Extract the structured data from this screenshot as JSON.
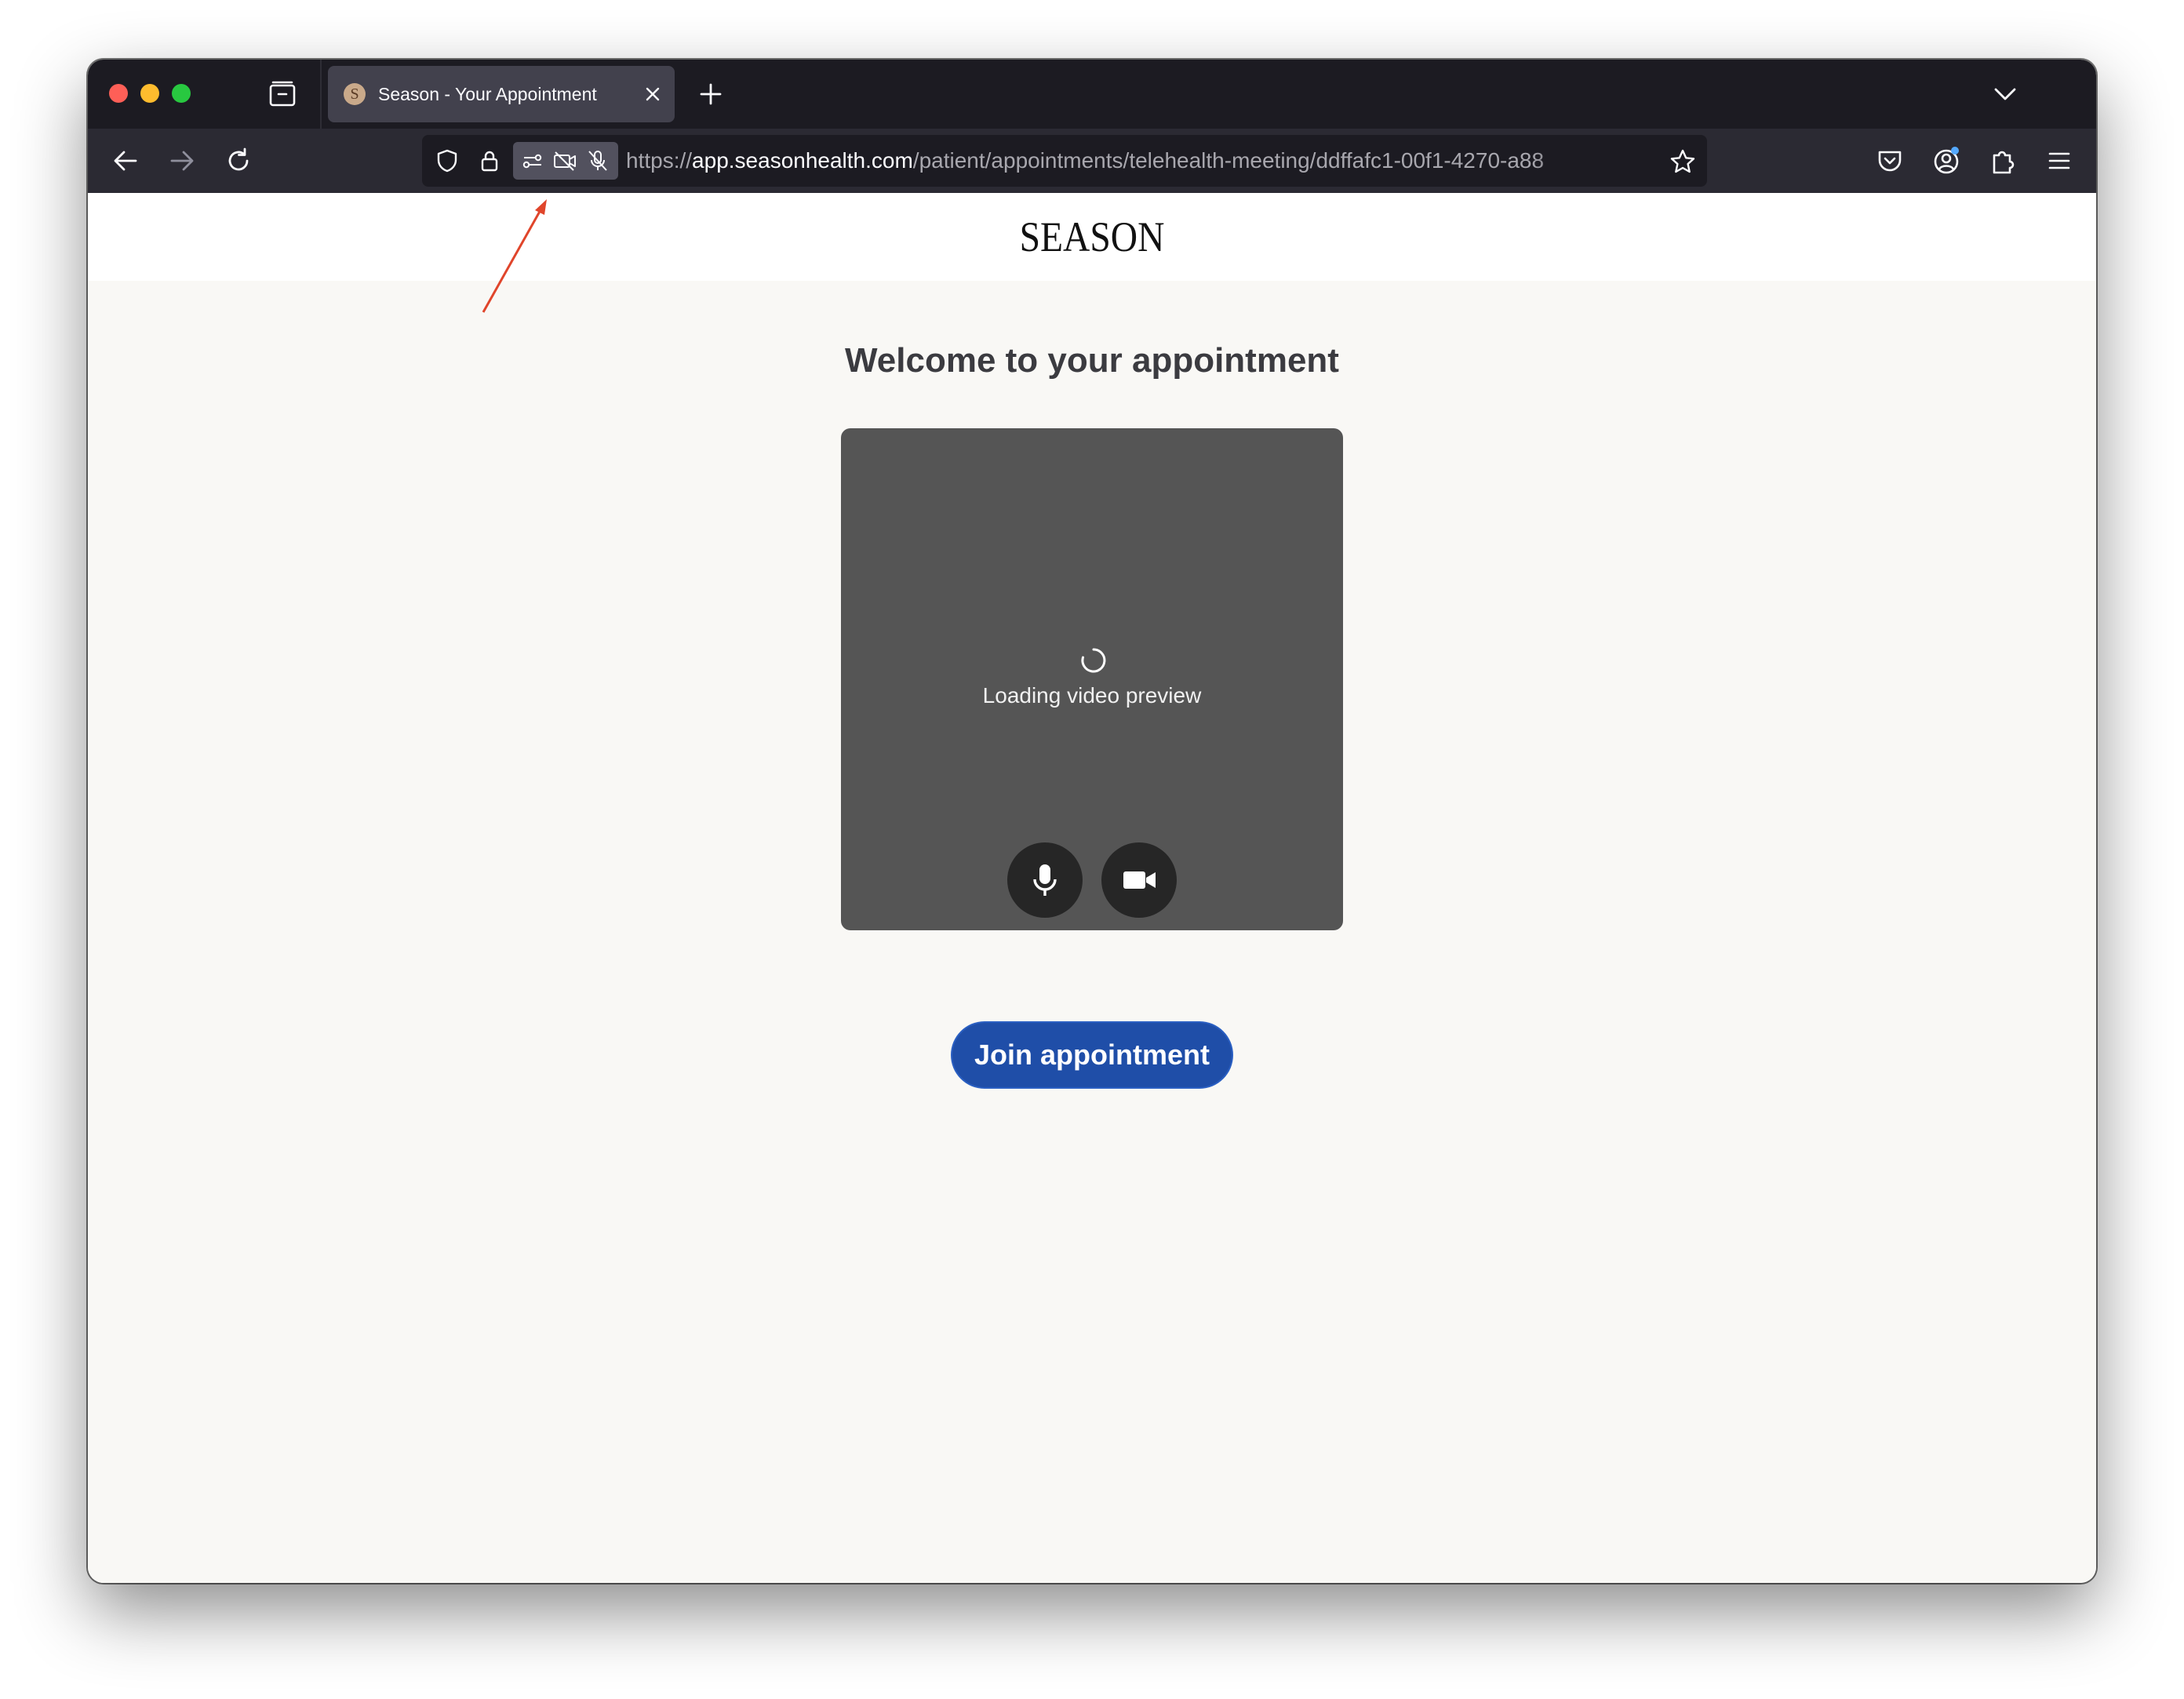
{
  "browser": {
    "tab": {
      "title": "Season - Your Appointment",
      "favicon_letter": "S"
    },
    "url": {
      "scheme": "https://",
      "host": "app.seasonhealth.com",
      "path": "/patient/appointments/telehealth-meeting/ddffafc1-00f1-4270-a88"
    },
    "icons": {
      "tab_overview": "tab-overview-icon",
      "close_tab": "close-icon",
      "new_tab": "plus-icon",
      "list_tabs": "chevron-down-icon",
      "back": "back-arrow-icon",
      "forward": "forward-arrow-icon",
      "reload": "reload-icon",
      "tracking_protection": "shield-icon",
      "secure": "lock-icon",
      "permissions": [
        "permissions-icon",
        "camera-blocked-icon",
        "microphone-blocked-icon"
      ],
      "bookmark": "star-icon",
      "pocket": "pocket-icon",
      "account": "account-icon",
      "extensions": "puzzle-icon",
      "menu": "hamburger-menu-icon"
    },
    "accent_colors": {
      "red": "#fe5f57",
      "yellow": "#febc2e",
      "green": "#28c840",
      "account_badge": "#54a9ff"
    }
  },
  "page": {
    "logo": "SEASON",
    "heading": "Welcome to your appointment",
    "preview": {
      "loading_text": "Loading video preview",
      "mic_button": "microphone-icon",
      "camera_button": "video-camera-icon"
    },
    "join_button_label": "Join appointment",
    "join_button_color": "#1f4ea8"
  },
  "annotation": {
    "type": "arrow",
    "color": "#e0452b",
    "target": "permissions-indicator"
  }
}
